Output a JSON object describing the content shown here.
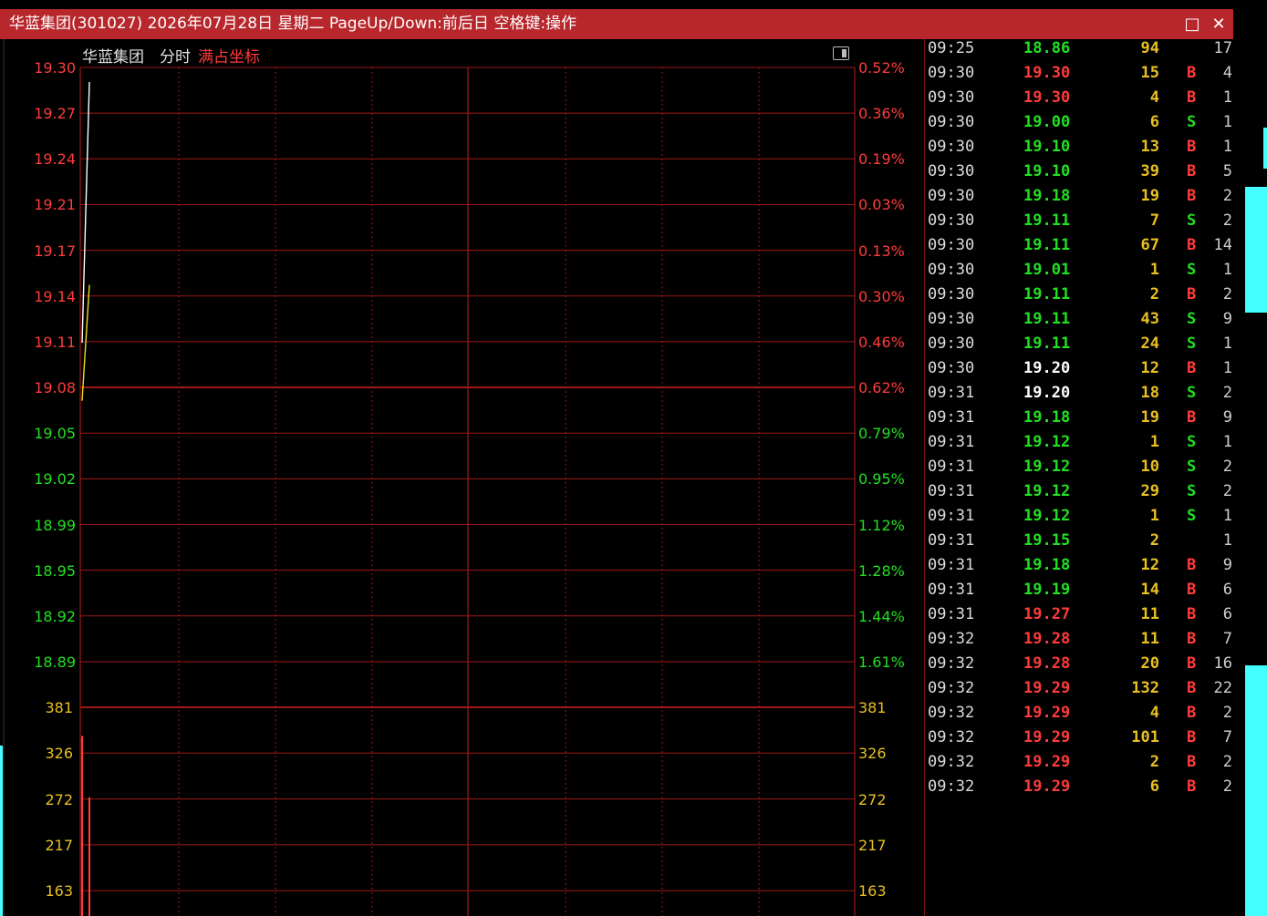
{
  "window": {
    "title": "华蓝集团(301027) 2026年07月28日 星期二 PageUp/Down:前后日 空格键:操作",
    "maximize_icon": "□",
    "close_icon": "✕"
  },
  "chart_header": {
    "stock_name": "华蓝集团",
    "mode": "分时",
    "option": "满占坐标"
  },
  "colors": {
    "title_bg": "#b7272c",
    "grid": "#a01818",
    "up": "#ff3b3b",
    "down": "#22e022",
    "flat": "#ffffff",
    "volume": "#e8c020",
    "avg_line": "#e8e020"
  },
  "chart_data": [
    {
      "type": "line",
      "panel": "price",
      "y_ticks_price": [
        "19.30",
        "19.27",
        "19.24",
        "19.21",
        "19.17",
        "19.14",
        "19.11",
        "19.08",
        "19.05",
        "19.02",
        "18.99",
        "18.95",
        "18.92",
        "18.89"
      ],
      "y_ticks_pct": [
        "0.52%",
        "0.36%",
        "0.19%",
        "0.03%",
        "0.13%",
        "0.30%",
        "0.46%",
        "0.62%",
        "0.79%",
        "0.95%",
        "1.12%",
        "1.28%",
        "1.44%",
        "1.61%"
      ],
      "ylim": [
        18.89,
        19.3
      ],
      "reference_price": 19.08,
      "grid": true,
      "series": [
        {
          "x": [
            "09:30",
            "09:31",
            "09:32"
          ],
          "values": [
            19.11,
            19.2,
            19.29
          ]
        },
        {
          "x": [
            "09:30",
            "09:31",
            "09:32"
          ],
          "values": [
            19.07,
            19.11,
            19.15
          ]
        }
      ]
    },
    {
      "type": "bar",
      "panel": "volume",
      "y_ticks": [
        "381",
        "326",
        "272",
        "217",
        "163"
      ],
      "ylim": [
        163,
        381
      ],
      "grid": true,
      "categories": [
        "09:30",
        "09:31",
        "09:32"
      ],
      "values": [
        347,
        0,
        274
      ]
    }
  ],
  "ticks": [
    {
      "time": "09:25",
      "price": "18.86",
      "vol": "94",
      "bs": "",
      "cnt": "17",
      "pc": "down"
    },
    {
      "time": "09:30",
      "price": "19.30",
      "vol": "15",
      "bs": "B",
      "cnt": "4",
      "pc": "up"
    },
    {
      "time": "09:30",
      "price": "19.30",
      "vol": "4",
      "bs": "B",
      "cnt": "1",
      "pc": "up"
    },
    {
      "time": "09:30",
      "price": "19.00",
      "vol": "6",
      "bs": "S",
      "cnt": "1",
      "pc": "down"
    },
    {
      "time": "09:30",
      "price": "19.10",
      "vol": "13",
      "bs": "B",
      "cnt": "1",
      "pc": "down"
    },
    {
      "time": "09:30",
      "price": "19.10",
      "vol": "39",
      "bs": "B",
      "cnt": "5",
      "pc": "down"
    },
    {
      "time": "09:30",
      "price": "19.18",
      "vol": "19",
      "bs": "B",
      "cnt": "2",
      "pc": "down"
    },
    {
      "time": "09:30",
      "price": "19.11",
      "vol": "7",
      "bs": "S",
      "cnt": "2",
      "pc": "down"
    },
    {
      "time": "09:30",
      "price": "19.11",
      "vol": "67",
      "bs": "B",
      "cnt": "14",
      "pc": "down"
    },
    {
      "time": "09:30",
      "price": "19.01",
      "vol": "1",
      "bs": "S",
      "cnt": "1",
      "pc": "down"
    },
    {
      "time": "09:30",
      "price": "19.11",
      "vol": "2",
      "bs": "B",
      "cnt": "2",
      "pc": "down"
    },
    {
      "time": "09:30",
      "price": "19.11",
      "vol": "43",
      "bs": "S",
      "cnt": "9",
      "pc": "down"
    },
    {
      "time": "09:30",
      "price": "19.11",
      "vol": "24",
      "bs": "S",
      "cnt": "1",
      "pc": "down"
    },
    {
      "time": "09:30",
      "price": "19.20",
      "vol": "12",
      "bs": "B",
      "cnt": "1",
      "pc": "flat"
    },
    {
      "time": "09:31",
      "price": "19.20",
      "vol": "18",
      "bs": "S",
      "cnt": "2",
      "pc": "flat"
    },
    {
      "time": "09:31",
      "price": "19.18",
      "vol": "19",
      "bs": "B",
      "cnt": "9",
      "pc": "down"
    },
    {
      "time": "09:31",
      "price": "19.12",
      "vol": "1",
      "bs": "S",
      "cnt": "1",
      "pc": "down"
    },
    {
      "time": "09:31",
      "price": "19.12",
      "vol": "10",
      "bs": "S",
      "cnt": "2",
      "pc": "down"
    },
    {
      "time": "09:31",
      "price": "19.12",
      "vol": "29",
      "bs": "S",
      "cnt": "2",
      "pc": "down"
    },
    {
      "time": "09:31",
      "price": "19.12",
      "vol": "1",
      "bs": "S",
      "cnt": "1",
      "pc": "down"
    },
    {
      "time": "09:31",
      "price": "19.15",
      "vol": "2",
      "bs": "",
      "cnt": "1",
      "pc": "down"
    },
    {
      "time": "09:31",
      "price": "19.18",
      "vol": "12",
      "bs": "B",
      "cnt": "9",
      "pc": "down"
    },
    {
      "time": "09:31",
      "price": "19.19",
      "vol": "14",
      "bs": "B",
      "cnt": "6",
      "pc": "down"
    },
    {
      "time": "09:31",
      "price": "19.27",
      "vol": "11",
      "bs": "B",
      "cnt": "6",
      "pc": "up"
    },
    {
      "time": "09:32",
      "price": "19.28",
      "vol": "11",
      "bs": "B",
      "cnt": "7",
      "pc": "up"
    },
    {
      "time": "09:32",
      "price": "19.28",
      "vol": "20",
      "bs": "B",
      "cnt": "16",
      "pc": "up"
    },
    {
      "time": "09:32",
      "price": "19.29",
      "vol": "132",
      "bs": "B",
      "cnt": "22",
      "pc": "up"
    },
    {
      "time": "09:32",
      "price": "19.29",
      "vol": "4",
      "bs": "B",
      "cnt": "2",
      "pc": "up"
    },
    {
      "time": "09:32",
      "price": "19.29",
      "vol": "101",
      "bs": "B",
      "cnt": "7",
      "pc": "up"
    },
    {
      "time": "09:32",
      "price": "19.29",
      "vol": "2",
      "bs": "B",
      "cnt": "2",
      "pc": "up"
    },
    {
      "time": "09:32",
      "price": "19.29",
      "vol": "6",
      "bs": "B",
      "cnt": "2",
      "pc": "up"
    }
  ]
}
